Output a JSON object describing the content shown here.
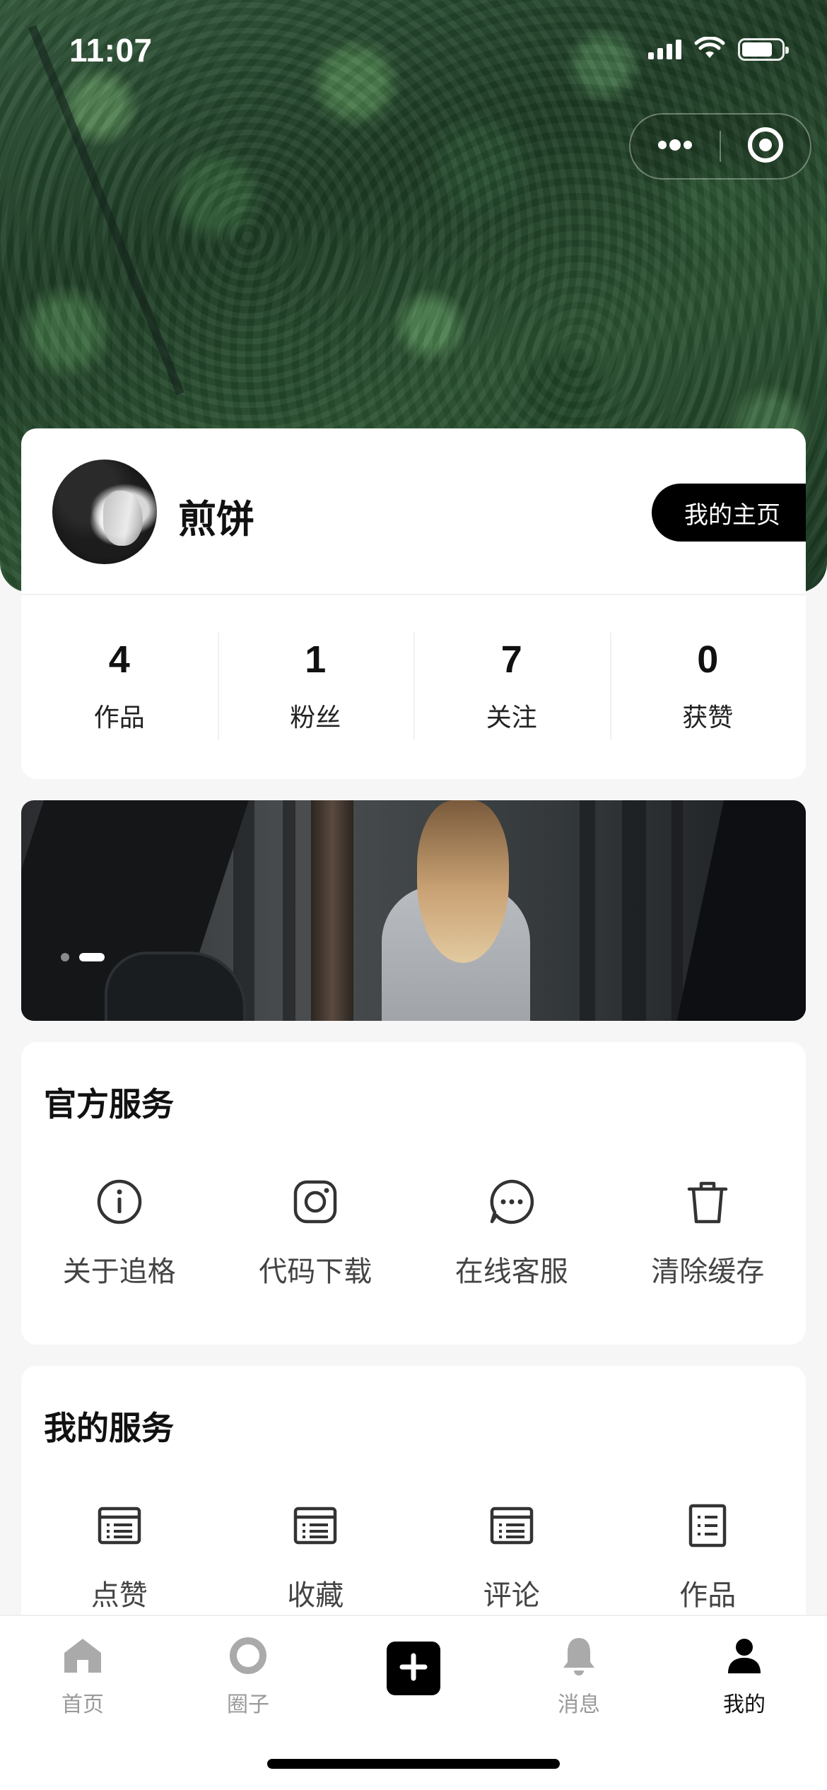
{
  "status_bar": {
    "time": "11:07",
    "icons": [
      "signal-icon",
      "wifi-icon",
      "battery-icon"
    ]
  },
  "capsule": {
    "more_icon": "more-dots-icon",
    "close_icon": "target-circle-icon"
  },
  "profile": {
    "nickname": "煎饼",
    "homepage_button": "我的主页",
    "stats": [
      {
        "value": "4",
        "label": "作品"
      },
      {
        "value": "1",
        "label": "粉丝"
      },
      {
        "value": "7",
        "label": "关注"
      },
      {
        "value": "0",
        "label": "获赞"
      }
    ]
  },
  "banner": {
    "slide_count": 2,
    "active_slide": 2
  },
  "official_services": {
    "title": "官方服务",
    "items": [
      {
        "label": "关于追格",
        "icon": "info-icon"
      },
      {
        "label": "代码下载",
        "icon": "instagram-icon"
      },
      {
        "label": "在线客服",
        "icon": "chat-icon"
      },
      {
        "label": "清除缓存",
        "icon": "trash-icon"
      }
    ]
  },
  "my_services": {
    "title": "我的服务",
    "items": [
      {
        "label": "点赞",
        "icon": "list-icon"
      },
      {
        "label": "收藏",
        "icon": "list-icon"
      },
      {
        "label": "评论",
        "icon": "list-icon"
      },
      {
        "label": "作品",
        "icon": "document-list-icon"
      }
    ]
  },
  "tabbar": {
    "tabs": [
      {
        "label": "首页",
        "icon": "home-icon",
        "active": false
      },
      {
        "label": "圈子",
        "icon": "circle-icon",
        "active": false
      },
      {
        "label": "",
        "icon": "plus-icon",
        "active": false
      },
      {
        "label": "消息",
        "icon": "bell-icon",
        "active": false
      },
      {
        "label": "我的",
        "icon": "user-icon",
        "active": true
      }
    ]
  },
  "colors": {
    "accent": "#000000",
    "page_background": "#f6f6f6",
    "inactive_tab": "#999999"
  }
}
